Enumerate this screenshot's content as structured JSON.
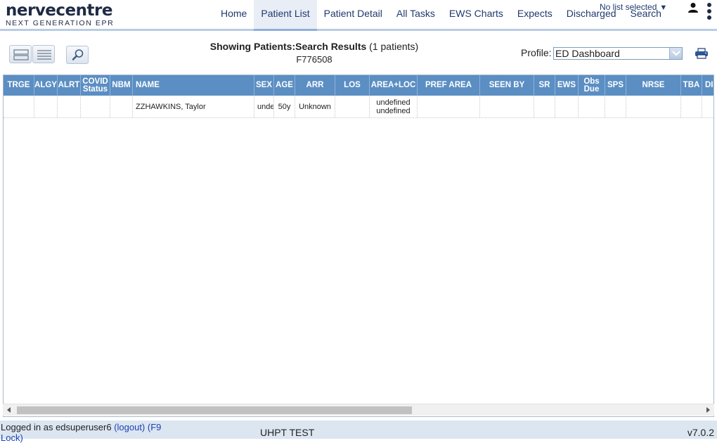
{
  "brand": {
    "name": "nervecentre",
    "tagline": "NEXT GENERATION EPR"
  },
  "nav": [
    {
      "label": "Home",
      "active": false
    },
    {
      "label": "Patient List",
      "active": true
    },
    {
      "label": "Patient Detail",
      "active": false
    },
    {
      "label": "All Tasks",
      "active": false
    },
    {
      "label": "EWS Charts",
      "active": false
    },
    {
      "label": "Expects",
      "active": false
    },
    {
      "label": "Discharged",
      "active": false
    },
    {
      "label": "Search",
      "active": false
    }
  ],
  "list_selector": {
    "label": "No list selected",
    "caret": "▼"
  },
  "showing": {
    "prefix": "Showing Patients:",
    "result_label": "Search Results",
    "count": "(1 patients)",
    "query": "F776508"
  },
  "profile": {
    "label": "Profile:",
    "value": "ED Dashboard"
  },
  "columns": [
    "TRGE",
    "ALGY",
    "ALRT",
    "COVID Status",
    "NBM",
    "NAME",
    "SEX",
    "AGE",
    "ARR",
    "LOS",
    "AREA+LOC",
    "PREF AREA",
    "SEEN BY",
    "SR",
    "EWS",
    "Obs Due",
    "SPS",
    "NRSE",
    "TBA",
    "DI"
  ],
  "rows": [
    {
      "trge": "",
      "algy": "",
      "alrt": "",
      "covid": "",
      "nbm": "",
      "name": "ZZHAWKINS, Taylor",
      "sex": "unde",
      "age": "50y",
      "arr": "Unknown",
      "los": "",
      "area": "undefined",
      "loc": "undefined",
      "pref_area": "",
      "seen_by": "",
      "sr": "",
      "ews": "",
      "obs_due": "",
      "sps": "",
      "nrse": "",
      "tba": "",
      "di": ""
    }
  ],
  "footer": {
    "logged_in": "Logged in as edsuperuser6",
    "logout": "(logout)",
    "lock": "(F9 Lock)",
    "environment": "UHPT TEST",
    "version": "v7.0.2"
  },
  "colors": {
    "header_accent": "#b9cce4",
    "grid_header": "#5b8ec3",
    "footer_bg": "#dce6f1",
    "link": "#1a3fb5",
    "nav_text": "#1f3a6e"
  }
}
